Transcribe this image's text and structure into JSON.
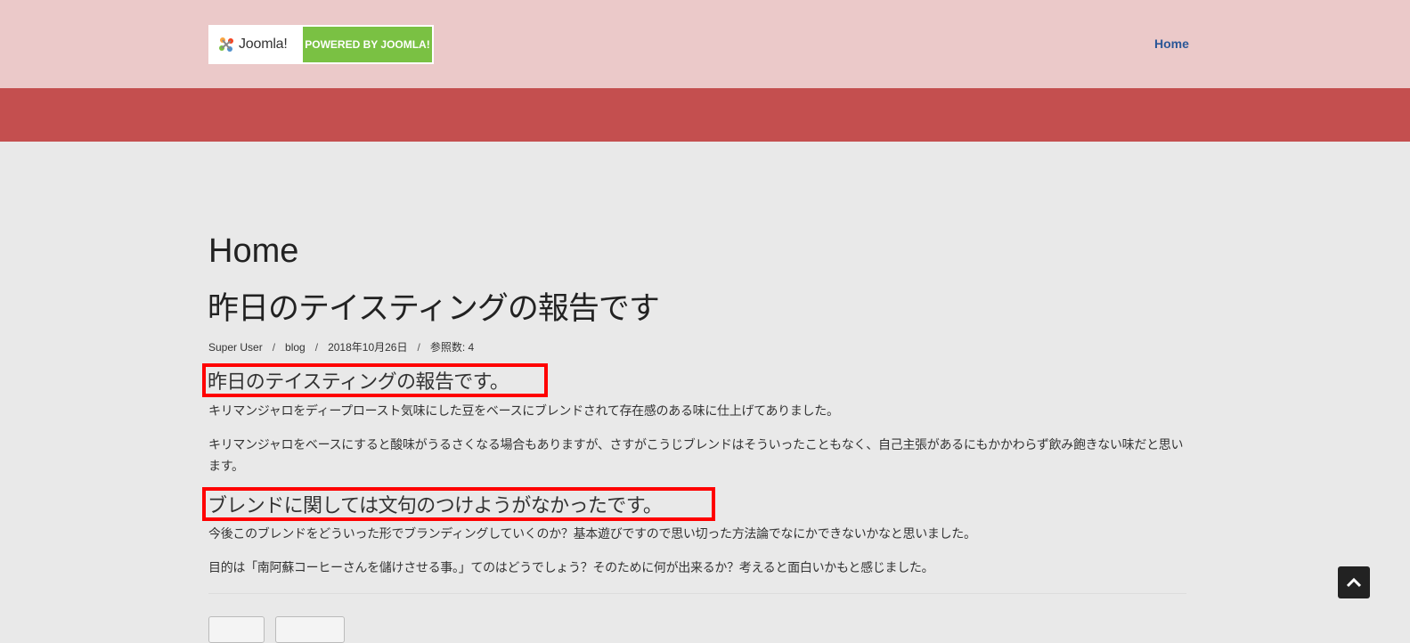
{
  "header": {
    "logo_text": "Joomla!",
    "logo_badge": "POWERED BY JOOMLA!",
    "nav_home": "Home"
  },
  "page_title": "Home",
  "article": {
    "title": "昨日のテイスティングの報告です",
    "meta": {
      "author": "Super User",
      "category": "blog",
      "date": "2018年10月26日",
      "hits": "参照数: 4"
    },
    "heading1": "昨日のテイスティングの報告です。",
    "para1": " キリマンジャロをディープロースト気味にした豆をベースにブレンドされて存在感のある味に仕上げてありました。",
    "para2": "キリマンジャロをベースにすると酸味がうるさくなる場合もありますが、さすがこうじブレンドはそういったこともなく、自己主張があるにもかかわらず飲み飽きない味だと思います。",
    "heading2": "ブレンドに関しては文句のつけようがなかったです。",
    "para3": "今後このブレンドをどういった形でブランディングしていくのか？基本遊びですので思い切った方法論でなにかできないかなと思いました。",
    "para4": "目的は「南阿蘇コーヒーさんを儲けさせる事。」てのはどうでしょう？そのために何が出来るか？考えると面白いかもと感じました。"
  },
  "icons": {
    "logo": "joomla-logo-icon",
    "back_to_top": "chevron-up-icon"
  },
  "colors": {
    "header_bg": "#ebc9c9",
    "banner_bg": "#c44f4f",
    "page_bg": "#e9e9e9",
    "nav_link": "#2b5797",
    "highlight_border": "#ff0000",
    "joomla_green": "#7ac143"
  }
}
